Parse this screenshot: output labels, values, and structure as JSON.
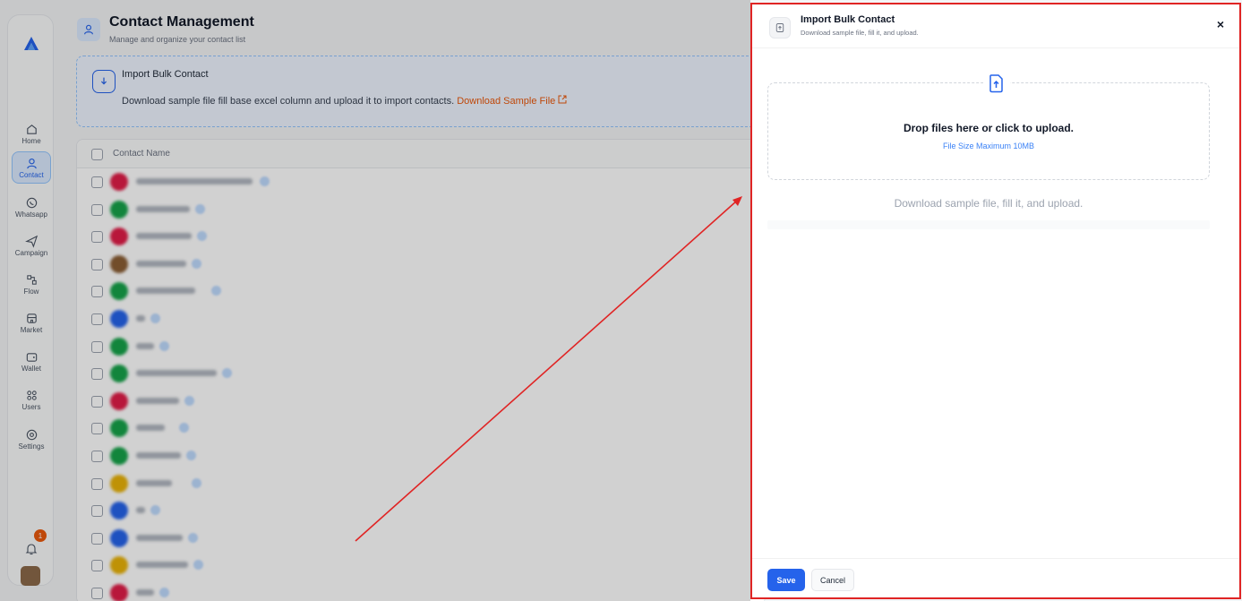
{
  "sidebar": {
    "items": [
      {
        "label": "Home",
        "icon": "home-icon"
      },
      {
        "label": "Contact",
        "icon": "user-icon"
      },
      {
        "label": "Whatsapp",
        "icon": "whatsapp-icon"
      },
      {
        "label": "Campaign",
        "icon": "send-icon"
      },
      {
        "label": "Flow",
        "icon": "flow-icon"
      },
      {
        "label": "Market",
        "icon": "store-icon"
      },
      {
        "label": "Wallet",
        "icon": "wallet-icon"
      },
      {
        "label": "Users",
        "icon": "users-icon"
      },
      {
        "label": "Settings",
        "icon": "settings-icon"
      }
    ],
    "notification_count": "1"
  },
  "page": {
    "title": "Contact Management",
    "subtitle": "Manage and organize your contact list"
  },
  "import_box": {
    "title": "Import Bulk Contact",
    "description": "Download sample file fill base excel column and upload it to import contacts.",
    "download_link": "Download Sample File"
  },
  "table": {
    "header": "Contact Name",
    "rows": [
      {
        "avatar_color": "#e11d48"
      },
      {
        "avatar_color": "#16a34a"
      },
      {
        "avatar_color": "#e11d48"
      },
      {
        "avatar_color": "#8b5e34"
      },
      {
        "avatar_color": "#16a34a"
      },
      {
        "avatar_color": "#2563eb"
      },
      {
        "avatar_color": "#16a34a"
      },
      {
        "avatar_color": "#16a34a"
      },
      {
        "avatar_color": "#e11d48"
      },
      {
        "avatar_color": "#16a34a"
      },
      {
        "avatar_color": "#16a34a"
      },
      {
        "avatar_color": "#eab308"
      },
      {
        "avatar_color": "#2563eb"
      },
      {
        "avatar_color": "#2563eb"
      },
      {
        "avatar_color": "#eab308"
      },
      {
        "avatar_color": "#e11d48"
      }
    ]
  },
  "drawer": {
    "title": "Import Bulk Contact",
    "subtitle": "Download sample file, fill it, and upload.",
    "close_label": "×",
    "dropzone_title": "Drop files here or click to upload.",
    "dropzone_size": "File Size Maximum 10MB",
    "hint": "Download sample file, fill it, and upload.",
    "save_label": "Save",
    "cancel_label": "Cancel"
  },
  "colors": {
    "accent": "#2563eb",
    "highlight_border": "#e02424",
    "link_orange": "#ea580c"
  }
}
